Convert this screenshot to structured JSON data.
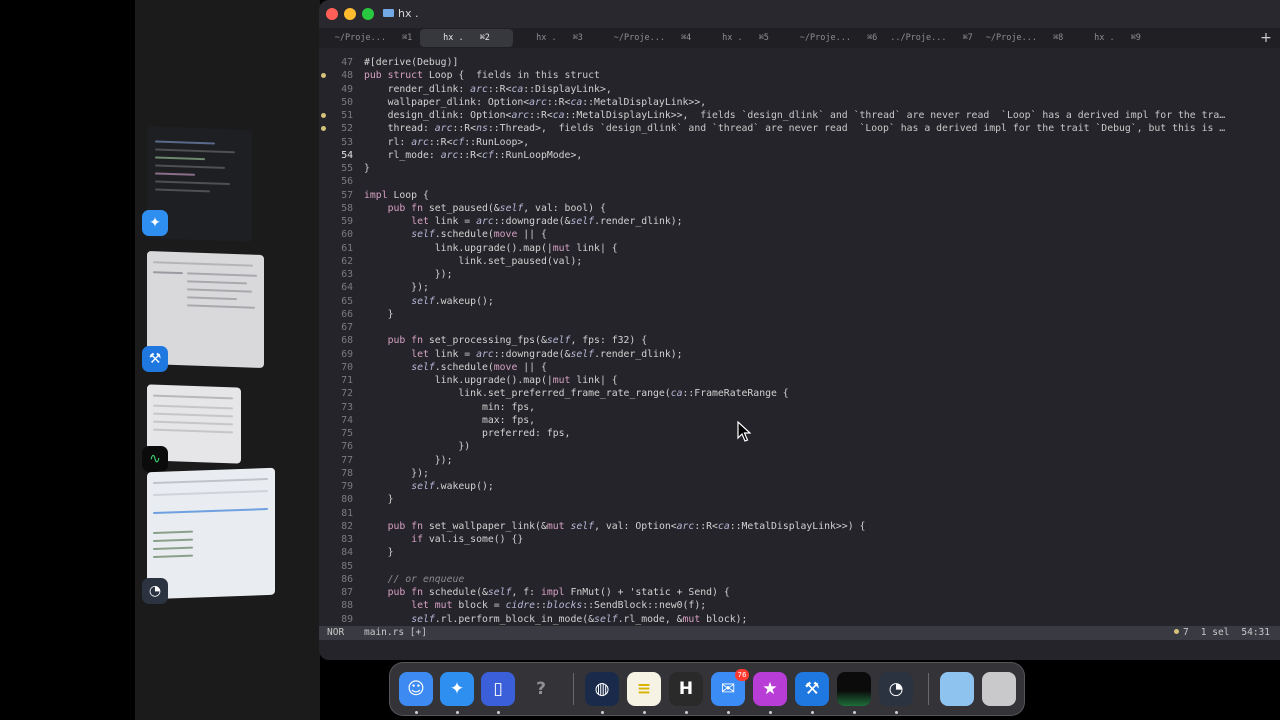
{
  "window": {
    "title": "hx ."
  },
  "tabs": [
    {
      "label": "~/Proje...",
      "shortcut": "⌘1"
    },
    {
      "label": "hx .",
      "shortcut": "⌘2",
      "active": true
    },
    {
      "label": "hx .",
      "shortcut": "⌘3"
    },
    {
      "label": "~/Proje...",
      "shortcut": "⌘4"
    },
    {
      "label": "hx .",
      "shortcut": "⌘5"
    },
    {
      "label": "~/Proje...",
      "shortcut": "⌘6"
    },
    {
      "label": "../Proje...",
      "shortcut": "⌘7"
    },
    {
      "label": "~/Proje...",
      "shortcut": "⌘8"
    },
    {
      "label": "hx .",
      "shortcut": "⌘9"
    }
  ],
  "code": {
    "lines": [
      {
        "n": "47",
        "html": "#[derive(Debug)]"
      },
      {
        "n": "48",
        "dot": true,
        "html": "<span class=\"kw\">pub struct</span> Loop {  <span class=\"diag\">fields in this struct</span>"
      },
      {
        "n": "49",
        "html": "    render_dlink: <span class=\"it\">arc</span>::R&lt;<span class=\"it\">ca</span>::DisplayLink&gt;,"
      },
      {
        "n": "50",
        "html": "    wallpaper_dlink: Option&lt;<span class=\"it\">arc</span>::R&lt;<span class=\"it\">ca</span>::MetalDisplayLink&gt;&gt;,"
      },
      {
        "n": "51",
        "dot": true,
        "html": "    design_dlink: Option&lt;<span class=\"it\">arc</span>::R&lt;<span class=\"it\">ca</span>::MetalDisplayLink&gt;&gt;,  <span class=\"diag\">fields `design_dlink` and `thread` are never read  `Loop` has a derived impl for the tra…</span>"
      },
      {
        "n": "52",
        "dot": true,
        "html": "    thread: <span class=\"it\">arc</span>::R&lt;<span class=\"it\">ns</span>::Thread&gt;,  <span class=\"diag\">fields `design_dlink` and `thread` are never read  `Loop` has a derived impl for the trait `Debug`, but this is …</span>"
      },
      {
        "n": "53",
        "html": "    rl: <span class=\"it\">arc</span>::R&lt;<span class=\"it\">cf</span>::RunLoop&gt;,"
      },
      {
        "n": "54",
        "cur": true,
        "html": "    rl_mode: <span class=\"it\">arc</span>::R&lt;<span class=\"it\">cf</span>::RunLoopMode&gt;,"
      },
      {
        "n": "55",
        "html": "}"
      },
      {
        "n": "56",
        "html": ""
      },
      {
        "n": "57",
        "html": "<span class=\"kw\">impl</span> Loop {"
      },
      {
        "n": "58",
        "html": "    <span class=\"kw\">pub fn</span> set_paused(&amp;<span class=\"it\">self</span>, val: bool) {"
      },
      {
        "n": "59",
        "html": "        <span class=\"kw\">let</span> link = <span class=\"it\">arc</span>::downgrade(&amp;<span class=\"it\">self</span>.render_dlink);"
      },
      {
        "n": "60",
        "html": "        <span class=\"it\">self</span>.schedule(<span class=\"kw\">move</span> || {"
      },
      {
        "n": "61",
        "html": "            link.upgrade().map(|<span class=\"kw\">mut</span> link| {"
      },
      {
        "n": "62",
        "html": "                link.set_paused(val);"
      },
      {
        "n": "63",
        "html": "            });"
      },
      {
        "n": "64",
        "html": "        });"
      },
      {
        "n": "65",
        "html": "        <span class=\"it\">self</span>.wakeup();"
      },
      {
        "n": "66",
        "html": "    }"
      },
      {
        "n": "67",
        "html": ""
      },
      {
        "n": "68",
        "html": "    <span class=\"kw\">pub fn</span> set_processing_fps(&amp;<span class=\"it\">self</span>, fps: f32) {"
      },
      {
        "n": "69",
        "html": "        <span class=\"kw\">let</span> link = <span class=\"it\">arc</span>::downgrade(&amp;<span class=\"it\">self</span>.render_dlink);"
      },
      {
        "n": "70",
        "html": "        <span class=\"it\">self</span>.schedule(<span class=\"kw\">move</span> || {"
      },
      {
        "n": "71",
        "html": "            link.upgrade().map(|<span class=\"kw\">mut</span> link| {"
      },
      {
        "n": "72",
        "html": "                link.set_preferred_frame_rate_range(<span class=\"it\">ca</span>::FrameRateRange {"
      },
      {
        "n": "73",
        "html": "                    min: fps,"
      },
      {
        "n": "74",
        "html": "                    max: fps,"
      },
      {
        "n": "75",
        "html": "                    preferred: fps,"
      },
      {
        "n": "76",
        "html": "                })"
      },
      {
        "n": "77",
        "html": "            });"
      },
      {
        "n": "78",
        "html": "        });"
      },
      {
        "n": "79",
        "html": "        <span class=\"it\">self</span>.wakeup();"
      },
      {
        "n": "80",
        "html": "    }"
      },
      {
        "n": "81",
        "html": ""
      },
      {
        "n": "82",
        "html": "    <span class=\"kw\">pub fn</span> set_wallpaper_link(&amp;<span class=\"kw\">mut</span> <span class=\"it\">self</span>, val: Option&lt;<span class=\"it\">arc</span>::R&lt;<span class=\"it\">ca</span>::MetalDisplayLink&gt;&gt;) {"
      },
      {
        "n": "83",
        "html": "        <span class=\"kw\">if</span> val.is_some() {}"
      },
      {
        "n": "84",
        "html": "    }"
      },
      {
        "n": "85",
        "html": ""
      },
      {
        "n": "86",
        "html": "    <span class=\"cm\">// or enqueue</span>"
      },
      {
        "n": "87",
        "html": "    <span class=\"kw\">pub fn</span> schedule(&amp;<span class=\"it\">self</span>, f: <span class=\"kw\">impl</span> FnMut() + 'static + Send) {"
      },
      {
        "n": "88",
        "html": "        <span class=\"kw\">let mut</span> block = <span class=\"it\">cidre</span>::<span class=\"it\">blocks</span>::SendBlock::new0(f);"
      },
      {
        "n": "89",
        "html": "        <span class=\"it\">self</span>.rl.perform_block_in_mode(&amp;<span class=\"it\">self</span>.rl_mode, &amp;<span class=\"kw\">mut</span> block);"
      }
    ]
  },
  "statusbar": {
    "mode": "NOR",
    "file": "main.rs [+]",
    "diagnostics": "7",
    "selections": "1 sel",
    "position": "54:31"
  },
  "dock": {
    "items": [
      {
        "name": "finder-icon",
        "glyph": "☺",
        "color": "#3d8bf2"
      },
      {
        "name": "safari-icon",
        "glyph": "✦",
        "color": "#2f8ff0"
      },
      {
        "name": "simulator-icon",
        "glyph": "▯",
        "color": "#3b5fd8"
      },
      {
        "name": "help-icon",
        "glyph": "?",
        "color": "transparent"
      },
      {
        "name": "xcode-instruments-icon",
        "glyph": "◍",
        "color": "#1a2a4a"
      },
      {
        "name": "notes-icon",
        "glyph": "≡",
        "color": "#f6f2e4"
      },
      {
        "name": "helix-icon",
        "glyph": "H",
        "color": "#2a2a2a"
      },
      {
        "name": "mail-icon",
        "glyph": "✉",
        "color": "#3b8cf5",
        "badge": "76"
      },
      {
        "name": "feedback-icon",
        "glyph": "★",
        "color": "#b83cd6"
      },
      {
        "name": "xcode-beta-icon",
        "glyph": "⚒",
        "color": "#1e78e0"
      },
      {
        "name": "activity-monitor-icon",
        "glyph": "",
        "color": "#0b0b0b"
      },
      {
        "name": "instruments-beta-icon",
        "glyph": "◔",
        "color": "#2b3240"
      },
      {
        "name": "downloads-folder-icon",
        "glyph": "",
        "color": "#8ec3f0"
      },
      {
        "name": "trash-icon",
        "glyph": "",
        "color": "#c9c9cc"
      }
    ]
  }
}
